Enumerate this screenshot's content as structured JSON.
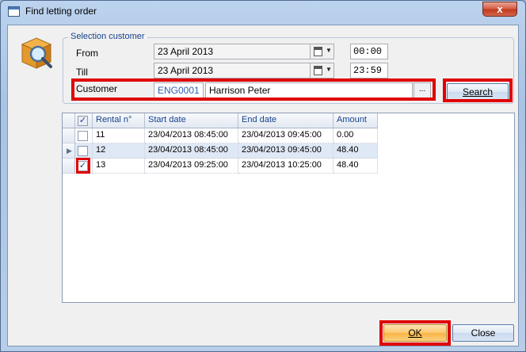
{
  "window": {
    "title": "Find letting order",
    "close_glyph": "x"
  },
  "selection": {
    "group_title": "Selection customer",
    "from_label": "From",
    "from_date": "23 April 2013",
    "from_time": "00:00",
    "till_label": "Till",
    "till_date": "23 April 2013",
    "till_time": "23:59",
    "customer_label": "Customer",
    "customer_code": "ENG0001",
    "customer_name": "Harrison Peter",
    "browse_label": "...",
    "search_label": "Search"
  },
  "grid": {
    "header_checked": true,
    "columns": [
      "Rental n°",
      "Start date",
      "End date",
      "Amount"
    ],
    "rows": [
      {
        "checked": false,
        "rental": "11",
        "start": "23/04/2013 08:45:00",
        "end": "23/04/2013 09:45:00",
        "amount": "0.00"
      },
      {
        "checked": false,
        "rental": "12",
        "start": "23/04/2013 08:45:00",
        "end": "23/04/2013 09:45:00",
        "amount": "48.40",
        "current": true
      },
      {
        "checked": true,
        "rental": "13",
        "start": "23/04/2013 09:25:00",
        "end": "23/04/2013 10:25:00",
        "amount": "48.40"
      }
    ]
  },
  "buttons": {
    "ok_label": "OK",
    "close_label": "Close"
  },
  "colors": {
    "highlight": "#e00000",
    "accent": "#15428b"
  },
  "icons": {
    "logo": "search-package-icon",
    "calendar": "calendar-icon"
  }
}
